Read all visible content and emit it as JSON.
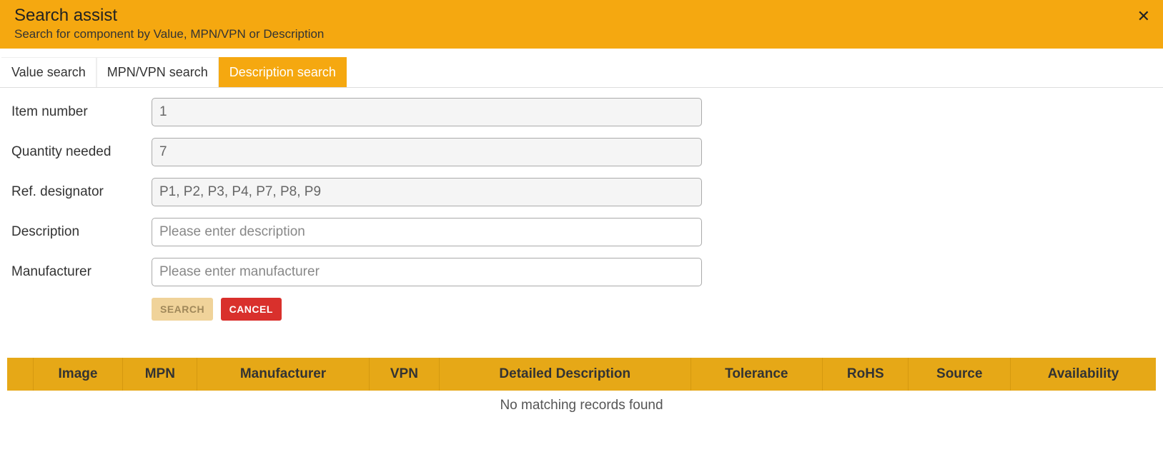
{
  "header": {
    "title": "Search assist",
    "subtitle": "Search for component by Value, MPN/VPN or Description",
    "close_glyph": "✕"
  },
  "tabs": [
    {
      "label": "Value search",
      "active": false
    },
    {
      "label": "MPN/VPN search",
      "active": false
    },
    {
      "label": "Description search",
      "active": true
    }
  ],
  "form": {
    "item_number": {
      "label": "Item number",
      "value": "1"
    },
    "quantity_needed": {
      "label": "Quantity needed",
      "value": "7"
    },
    "ref_designator": {
      "label": "Ref. designator",
      "value": "P1, P2, P3, P4, P7, P8, P9"
    },
    "description": {
      "label": "Description",
      "value": "",
      "placeholder": "Please enter description"
    },
    "manufacturer": {
      "label": "Manufacturer",
      "value": "",
      "placeholder": "Please enter manufacturer"
    }
  },
  "buttons": {
    "search": "SEARCH",
    "cancel": "CANCEL"
  },
  "table": {
    "columns": [
      "",
      "Image",
      "MPN",
      "Manufacturer",
      "VPN",
      "Detailed Description",
      "Tolerance",
      "RoHS",
      "Source",
      "Availability"
    ],
    "empty_message": "No matching records found"
  }
}
